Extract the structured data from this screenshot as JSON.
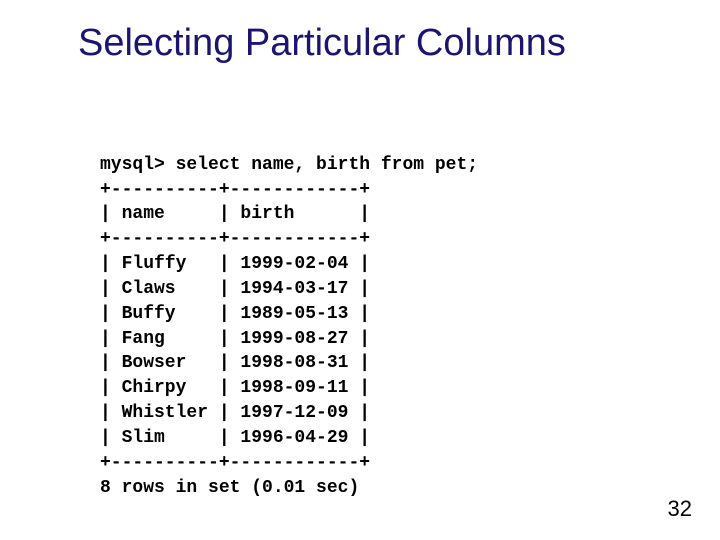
{
  "title": "Selecting Particular Columns",
  "page_number": "32",
  "terminal": {
    "prompt": "mysql>",
    "command": " select name, birth from pet;",
    "rule": "+----------+------------+",
    "header": "| name     | birth      |",
    "rows": [
      "| Fluffy   | 1999-02-04 |",
      "| Claws    | 1994-03-17 |",
      "| Buffy    | 1989-05-13 |",
      "| Fang     | 1999-08-27 |",
      "| Bowser   | 1998-08-31 |",
      "| Chirpy   | 1998-09-11 |",
      "| Whistler | 1997-12-09 |",
      "| Slim     | 1996-04-29 |"
    ],
    "footer": "8 rows in set (0.01 sec)"
  },
  "chart_data": {
    "type": "table",
    "title": "select name, birth from pet;",
    "columns": [
      "name",
      "birth"
    ],
    "rows": [
      [
        "Fluffy",
        "1999-02-04"
      ],
      [
        "Claws",
        "1994-03-17"
      ],
      [
        "Buffy",
        "1989-05-13"
      ],
      [
        "Fang",
        "1999-08-27"
      ],
      [
        "Bowser",
        "1998-08-31"
      ],
      [
        "Chirpy",
        "1998-09-11"
      ],
      [
        "Whistler",
        "1997-12-09"
      ],
      [
        "Slim",
        "1996-04-29"
      ]
    ],
    "rowcount": 8,
    "elapsed_sec": 0.01
  }
}
